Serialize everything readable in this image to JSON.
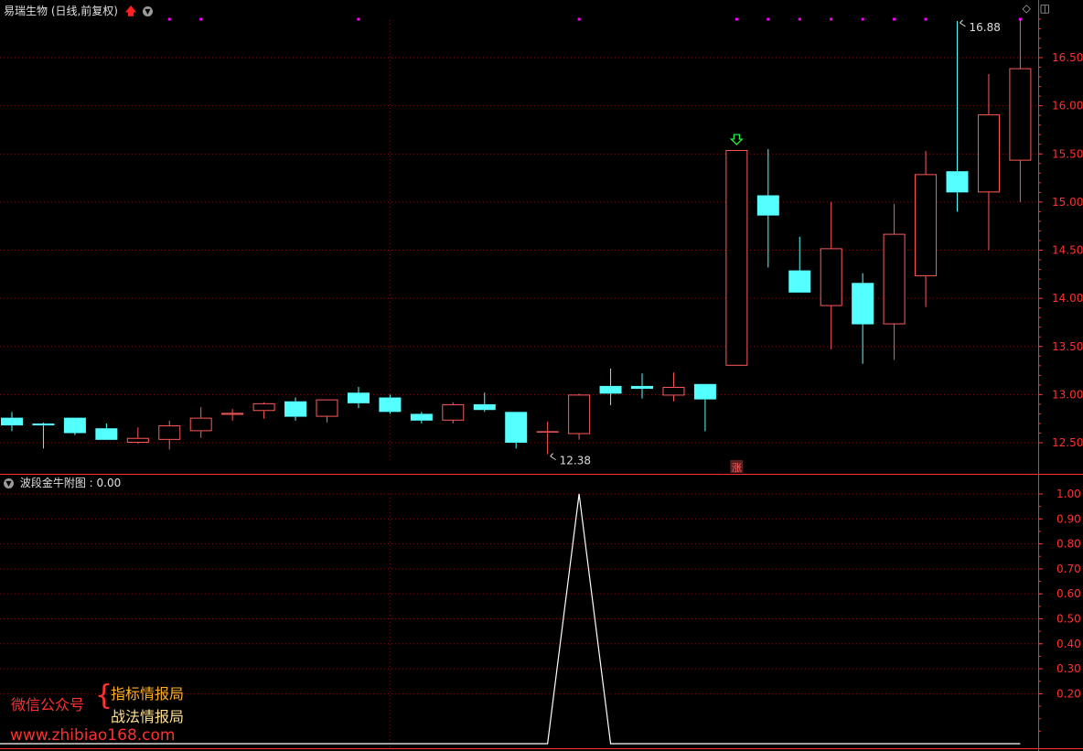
{
  "header": {
    "title": "易瑞生物 (日线,前复权)",
    "dropdown_icon": "chevron-down-icon",
    "up_icon": "red-up-arrow-icon",
    "right_icons": [
      "diamond-icon",
      "panel-toggle-icon"
    ]
  },
  "indicator": {
    "name": "波段金牛附图",
    "separator": ":",
    "value": "0.00"
  },
  "watermark": {
    "label": "微信公众号",
    "brace": "{",
    "line1": "指标情报局",
    "line2": "战法情报局",
    "url": "www.zhibiao168.com"
  },
  "colors": {
    "up": "#ff5a5a",
    "down": "#54ffff",
    "grid": "#7a1010",
    "axis_text": "#ff3030",
    "line": "#ffffff",
    "marker": "#ff00ff",
    "signal_arrow": "#22ff44"
  },
  "chart_data": [
    {
      "type": "candlestick",
      "title": "",
      "ylim": [
        12.3,
        16.95
      ],
      "yticks": [
        "12.50",
        "13.00",
        "13.50",
        "14.00",
        "14.50",
        "15.00",
        "15.50",
        "16.00",
        "16.50"
      ],
      "grid": true,
      "candles": [
        {
          "o": 12.76,
          "h": 12.82,
          "l": 12.62,
          "c": 12.68
        },
        {
          "o": 12.7,
          "h": 12.71,
          "l": 12.44,
          "c": 12.68
        },
        {
          "o": 12.76,
          "h": 12.76,
          "l": 12.58,
          "c": 12.6
        },
        {
          "o": 12.65,
          "h": 12.7,
          "l": 12.53,
          "c": 12.53
        },
        {
          "o": 12.5,
          "h": 12.66,
          "l": 12.49,
          "c": 12.55
        },
        {
          "o": 12.53,
          "h": 12.73,
          "l": 12.43,
          "c": 12.68
        },
        {
          "o": 12.62,
          "h": 12.87,
          "l": 12.55,
          "c": 12.76
        },
        {
          "o": 12.79,
          "h": 12.85,
          "l": 12.73,
          "c": 12.81
        },
        {
          "o": 12.83,
          "h": 12.92,
          "l": 12.75,
          "c": 12.91
        },
        {
          "o": 12.93,
          "h": 12.97,
          "l": 12.73,
          "c": 12.77
        },
        {
          "o": 12.77,
          "h": 12.95,
          "l": 12.71,
          "c": 12.95
        },
        {
          "o": 13.02,
          "h": 13.08,
          "l": 12.86,
          "c": 12.91
        },
        {
          "o": 12.97,
          "h": 13.0,
          "l": 12.8,
          "c": 12.82
        },
        {
          "o": 12.8,
          "h": 12.82,
          "l": 12.7,
          "c": 12.73
        },
        {
          "o": 12.73,
          "h": 12.92,
          "l": 12.7,
          "c": 12.9
        },
        {
          "o": 12.9,
          "h": 13.02,
          "l": 12.82,
          "c": 12.84
        },
        {
          "o": 12.82,
          "h": 12.82,
          "l": 12.44,
          "c": 12.5
        },
        {
          "o": 12.61,
          "h": 12.72,
          "l": 12.38,
          "c": 12.62
        },
        {
          "o": 12.59,
          "h": 13.01,
          "l": 12.53,
          "c": 13.0
        },
        {
          "o": 13.09,
          "h": 13.27,
          "l": 12.89,
          "c": 13.01
        },
        {
          "o": 13.09,
          "h": 13.22,
          "l": 12.96,
          "c": 13.06
        },
        {
          "o": 12.99,
          "h": 13.23,
          "l": 12.93,
          "c": 13.08
        },
        {
          "o": 13.11,
          "h": 13.11,
          "l": 12.62,
          "c": 12.95
        },
        {
          "o": 13.3,
          "h": 15.54,
          "l": 13.3,
          "c": 15.54
        },
        {
          "o": 15.07,
          "h": 15.55,
          "l": 14.32,
          "c": 14.86
        },
        {
          "o": 14.29,
          "h": 14.64,
          "l": 14.06,
          "c": 14.06
        },
        {
          "o": 13.92,
          "h": 15.0,
          "l": 13.47,
          "c": 14.52
        },
        {
          "o": 14.16,
          "h": 14.26,
          "l": 13.32,
          "c": 13.73
        },
        {
          "o": 13.73,
          "h": 14.98,
          "l": 13.36,
          "c": 14.67
        },
        {
          "o": 14.23,
          "h": 15.53,
          "l": 13.91,
          "c": 15.29
        },
        {
          "o": 15.32,
          "h": 16.88,
          "l": 14.9,
          "c": 15.1
        },
        {
          "o": 15.1,
          "h": 16.33,
          "l": 14.5,
          "c": 15.91
        },
        {
          "o": 15.43,
          "h": 16.89,
          "l": 15.0,
          "c": 16.39
        }
      ],
      "annotations": [
        {
          "text": "16.88",
          "index": 30,
          "value": 16.88
        },
        {
          "text": "12.38",
          "index": 17,
          "value": 12.38
        }
      ],
      "signals": {
        "down_arrow_index": 23,
        "zhang_badge": "涨",
        "zhang_index": 23,
        "markers_at": [
          5,
          6,
          11,
          18,
          23,
          24,
          25,
          26,
          27,
          28,
          29,
          32
        ]
      },
      "dotted_vline_index": 12
    },
    {
      "type": "line",
      "title": "",
      "ylim": [
        0,
        1.05
      ],
      "yticks": [
        "0.20",
        "0.30",
        "0.40",
        "0.50",
        "0.60",
        "0.70",
        "0.80",
        "0.90",
        "1.00"
      ],
      "grid": true,
      "x": [
        0,
        1,
        2,
        3,
        4,
        5,
        6,
        7,
        8,
        9,
        10,
        11,
        12,
        13,
        14,
        15,
        16,
        17,
        18,
        19,
        20,
        21,
        22,
        23,
        24,
        25,
        26,
        27,
        28,
        29,
        30,
        31,
        32
      ],
      "values": [
        0,
        0,
        0,
        0,
        0,
        0,
        0,
        0,
        0,
        0,
        0,
        0,
        0,
        0,
        0,
        0,
        0,
        0,
        1,
        0,
        0,
        0,
        0,
        0,
        0,
        0,
        0,
        0,
        0,
        0,
        0,
        0,
        0
      ]
    }
  ]
}
